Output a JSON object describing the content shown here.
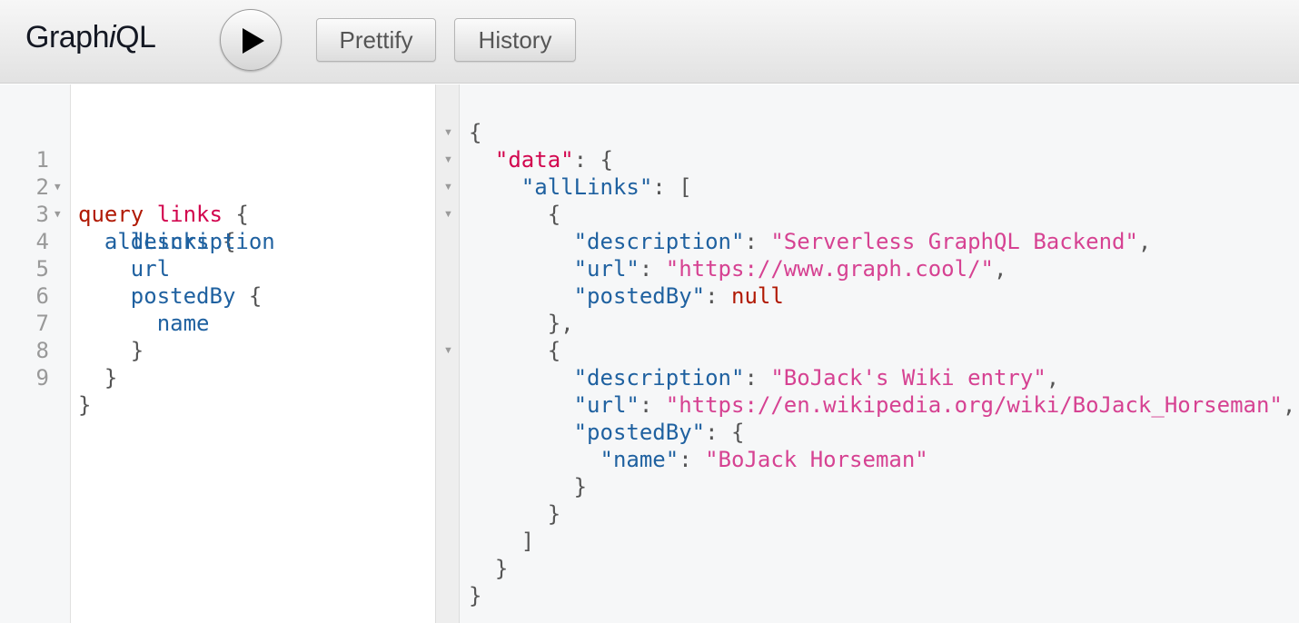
{
  "app": {
    "title_prefix": "Graph",
    "title_italic": "i",
    "title_suffix": "QL"
  },
  "toolbar": {
    "execute_icon": "play-icon",
    "prettify_label": "Prettify",
    "history_label": "History"
  },
  "query_editor": {
    "line_numbers": [
      "1",
      "2",
      "3",
      "4",
      "5",
      "6",
      "7",
      "8",
      "9"
    ],
    "lines": {
      "l1": {
        "keyword": "query",
        "name": "links",
        "brace": "{"
      },
      "l2": {
        "field": "allLinks",
        "brace": "{"
      },
      "l3": {
        "field": "description"
      },
      "l4": {
        "field": "url"
      },
      "l5": {
        "field": "postedBy",
        "brace": "{"
      },
      "l6": {
        "field": "name"
      },
      "l7": {
        "brace": "}"
      },
      "l8": {
        "brace": "}"
      },
      "l9": {
        "brace": "}"
      }
    }
  },
  "result": {
    "open": "{",
    "data_key": "\"data\"",
    "all_links_key": "\"allLinks\"",
    "items": [
      {
        "description_key": "\"description\"",
        "description": "\"Serverless GraphQL Backend\"",
        "url_key": "\"url\"",
        "url": "\"https://www.graph.cool/\"",
        "posted_by_key": "\"postedBy\"",
        "posted_by": "null"
      },
      {
        "description_key": "\"description\"",
        "description": "\"BoJack's Wiki entry\"",
        "url_key": "\"url\"",
        "url": "\"https://en.wikipedia.org/wiki/BoJack_Horseman\"",
        "posted_by_key": "\"postedBy\"",
        "name_key": "\"name\"",
        "name": "\"BoJack Horseman\""
      }
    ]
  }
}
